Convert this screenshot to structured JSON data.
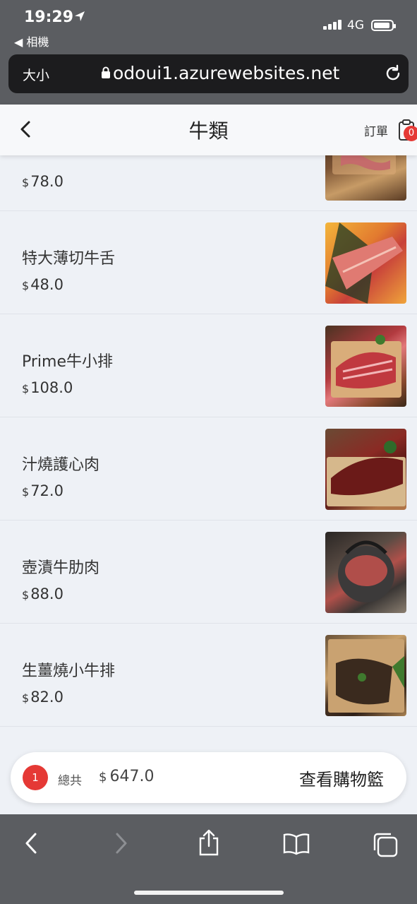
{
  "status_bar": {
    "time": "19:29",
    "back_app": "◀ 相機",
    "network": "4G"
  },
  "browser": {
    "text_size": "大小",
    "url": "odoui1.azurewebsites.net"
  },
  "header": {
    "title": "牛類",
    "order_label": "訂單",
    "order_count": "0"
  },
  "items": [
    {
      "name": "",
      "currency": "$",
      "price": "78.0"
    },
    {
      "name": "特大薄切牛舌",
      "currency": "$",
      "price": "48.0"
    },
    {
      "name": "Prime牛小排",
      "currency": "$",
      "price": "108.0"
    },
    {
      "name": "汁燒護心肉",
      "currency": "$",
      "price": "72.0"
    },
    {
      "name": "壺漬牛肋肉",
      "currency": "$",
      "price": "88.0"
    },
    {
      "name": "生薑燒小牛排",
      "currency": "$",
      "price": "82.0"
    }
  ],
  "cart": {
    "count": "1",
    "total_label": "總共",
    "currency": "$",
    "total": "647.0",
    "view_button": "查看購物籃"
  },
  "colors": {
    "accent_red": "#e53935",
    "page_bg": "#eef1f6",
    "browser_chrome": "#5b5d61"
  }
}
